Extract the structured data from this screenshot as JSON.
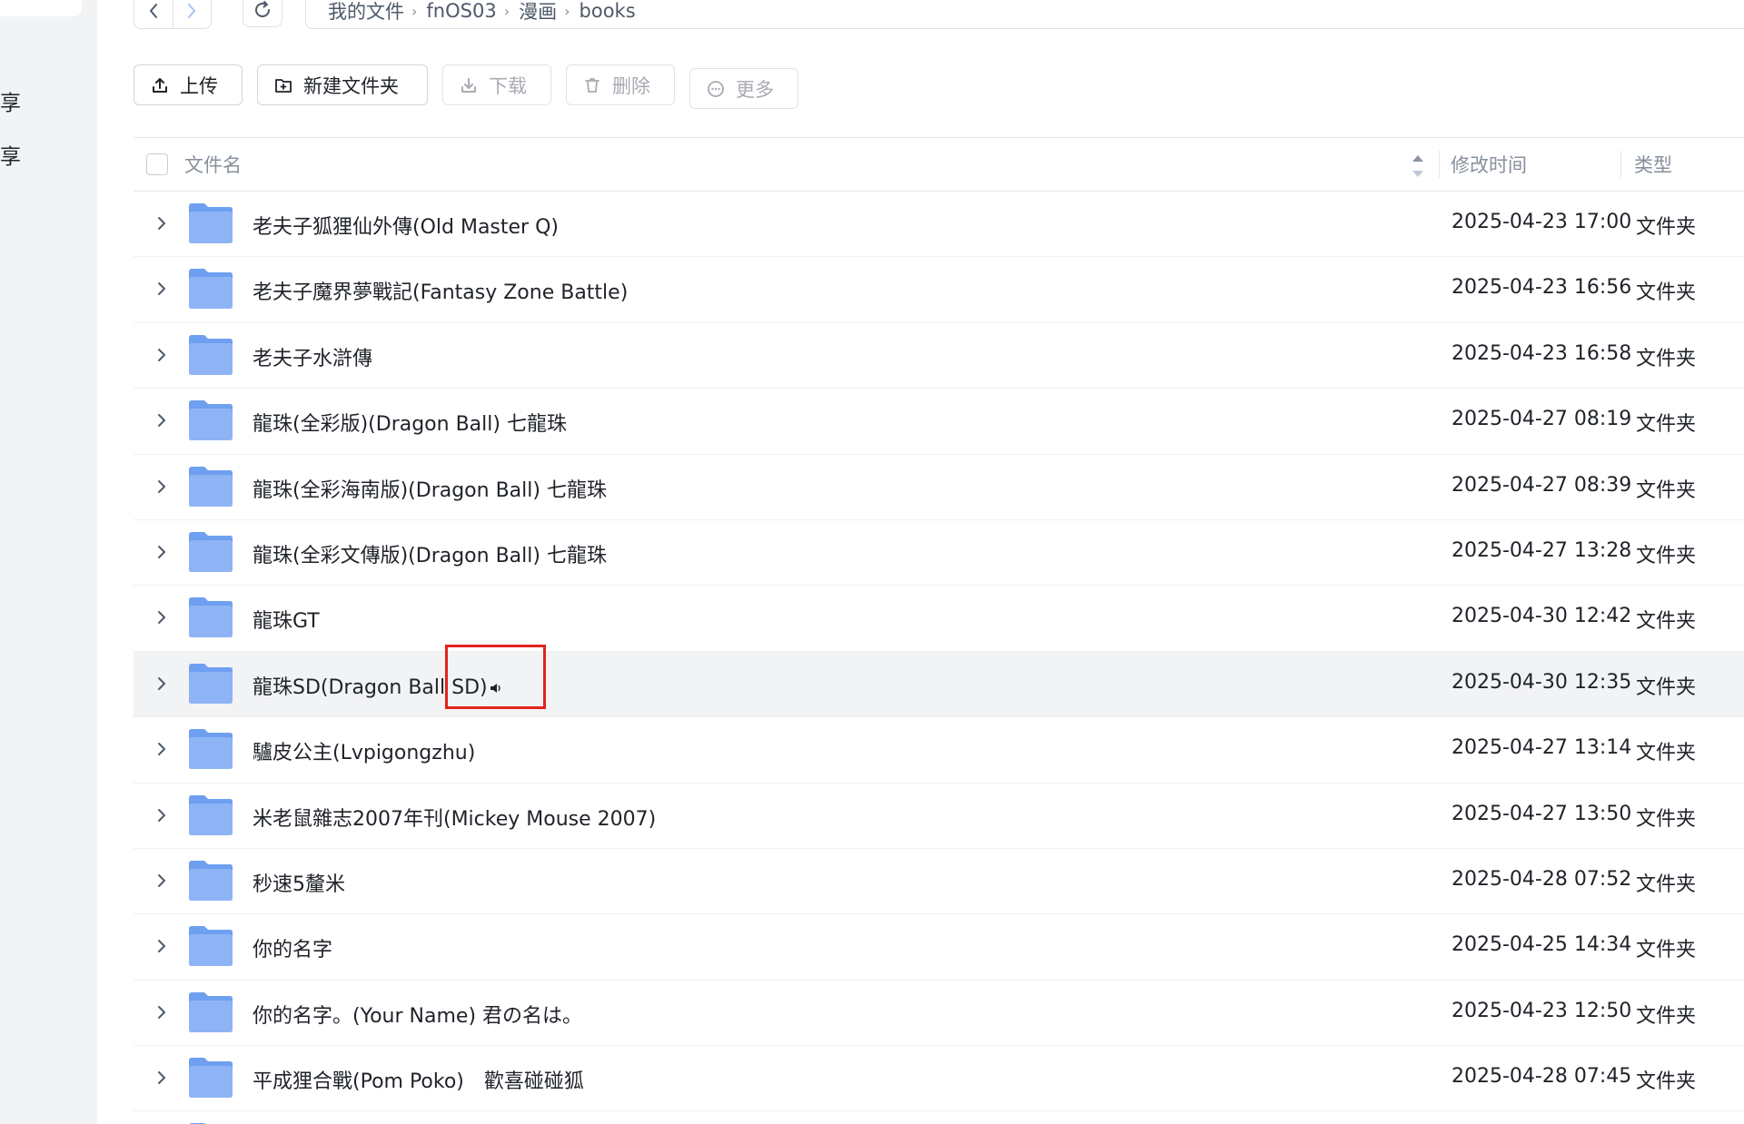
{
  "sidebar": {
    "items": [
      {
        "label": "享"
      },
      {
        "label": "享"
      }
    ]
  },
  "nav": {
    "back_icon": "chevron-left-icon",
    "forward_icon": "chevron-right-icon",
    "refresh_icon": "refresh-icon"
  },
  "breadcrumb": {
    "items": [
      {
        "label": "我的文件"
      },
      {
        "label": "fnOS03"
      },
      {
        "label": "漫画"
      },
      {
        "label": "books"
      }
    ]
  },
  "toolbar": {
    "upload_label": "上传",
    "new_folder_label": "新建文件夹",
    "download_label": "下载",
    "delete_label": "删除",
    "more_label": "更多"
  },
  "table": {
    "headers": {
      "name": "文件名",
      "modified": "修改时间",
      "type": "类型"
    },
    "rows": [
      {
        "name": "老夫子狐狸仙外傳(Old Master Q)",
        "modified": "2025-04-23 17:00",
        "type": "文件夹"
      },
      {
        "name": "老夫子魔界夢戰記(Fantasy Zone Battle)",
        "modified": "2025-04-23 16:56",
        "type": "文件夹"
      },
      {
        "name": "老夫子水滸傳",
        "modified": "2025-04-23 16:58",
        "type": "文件夹"
      },
      {
        "name": "龍珠(全彩版)(Dragon Ball) 七龍珠",
        "modified": "2025-04-27 08:19",
        "type": "文件夹"
      },
      {
        "name": "龍珠(全彩海南版)(Dragon Ball) 七龍珠",
        "modified": "2025-04-27 08:39",
        "type": "文件夹"
      },
      {
        "name": "龍珠(全彩文傳版)(Dragon Ball) 七龍珠",
        "modified": "2025-04-27 13:28",
        "type": "文件夹"
      },
      {
        "name": "龍珠GT",
        "modified": "2025-04-30 12:42",
        "type": "文件夹"
      },
      {
        "name": "龍珠SD(Dragon Ball SD)",
        "modified": "2025-04-30 12:35",
        "type": "文件夹"
      },
      {
        "name": "驢皮公主(Lvpigongzhu)",
        "modified": "2025-04-27 13:14",
        "type": "文件夹"
      },
      {
        "name": "米老鼠雜志2007年刊(Mickey Mouse 2007)",
        "modified": "2025-04-27 13:50",
        "type": "文件夹"
      },
      {
        "name": "秒速5釐米",
        "modified": "2025-04-28 07:52",
        "type": "文件夹"
      },
      {
        "name": "你的名字",
        "modified": "2025-04-25 14:34",
        "type": "文件夹"
      },
      {
        "name": "你的名字。(Your Name) 君の名は。",
        "modified": "2025-04-23 12:50",
        "type": "文件夹"
      },
      {
        "name": "平成狸合戰(Pom Poko)　歡喜碰碰狐",
        "modified": "2025-04-28 07:45",
        "type": "文件夹"
      }
    ]
  },
  "colors": {
    "folder": "#8fb4f5",
    "highlight": "#e0241c",
    "hover_row": "#f2f3f5"
  }
}
